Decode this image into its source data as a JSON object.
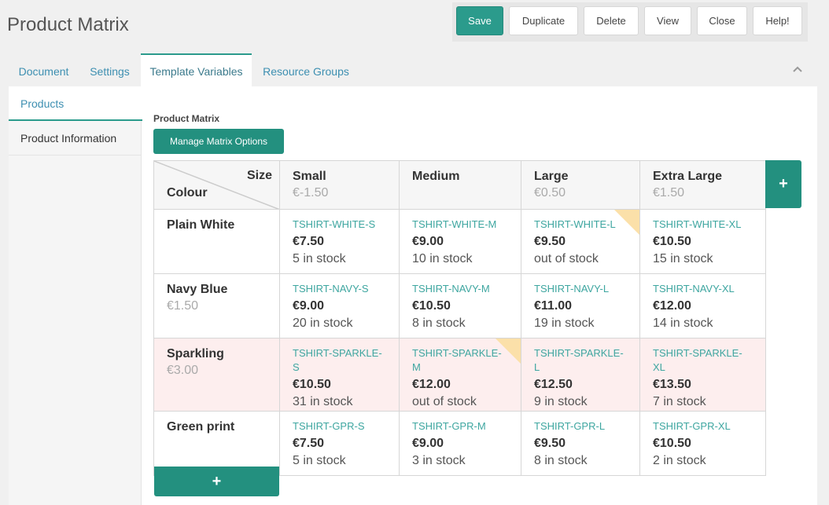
{
  "page": {
    "title": "Product Matrix"
  },
  "toolbar": {
    "save": "Save",
    "duplicate": "Duplicate",
    "delete": "Delete",
    "view": "View",
    "close": "Close",
    "help": "Help!"
  },
  "tabs": [
    "Document",
    "Settings",
    "Template Variables",
    "Resource Groups"
  ],
  "active_tab": "Template Variables",
  "vertical_tabs": [
    "Products",
    "Product Information"
  ],
  "active_vertical_tab": "Products",
  "field": {
    "label": "Product Matrix",
    "manage_button": "Manage Matrix Options",
    "add_column_icon": "+",
    "add_row_icon": "+"
  },
  "matrix": {
    "corner": {
      "size": "Size",
      "colour": "Colour"
    },
    "columns": [
      {
        "name": "Small",
        "price": "€-1.50"
      },
      {
        "name": "Medium",
        "price": ""
      },
      {
        "name": "Large",
        "price": "€0.50"
      },
      {
        "name": "Extra Large",
        "price": "€1.50"
      }
    ],
    "rows": [
      {
        "name": "Plain White",
        "price": "",
        "highlight": false,
        "cells": [
          {
            "sku": "TSHIRT-WHITE-S",
            "price": "€7.50",
            "stock": "5 in stock"
          },
          {
            "sku": "TSHIRT-WHITE-M",
            "price": "€9.00",
            "stock": "10 in stock"
          },
          {
            "sku": "TSHIRT-WHITE-L",
            "price": "€9.50",
            "stock": "out of stock",
            "flag": true
          },
          {
            "sku": "TSHIRT-WHITE-XL",
            "price": "€10.50",
            "stock": "15 in stock"
          }
        ]
      },
      {
        "name": "Navy Blue",
        "price": "€1.50",
        "highlight": false,
        "cells": [
          {
            "sku": "TSHIRT-NAVY-S",
            "price": "€9.00",
            "stock": "20 in stock"
          },
          {
            "sku": "TSHIRT-NAVY-M",
            "price": "€10.50",
            "stock": "8 in stock"
          },
          {
            "sku": "TSHIRT-NAVY-L",
            "price": "€11.00",
            "stock": "19 in stock"
          },
          {
            "sku": "TSHIRT-NAVY-XL",
            "price": "€12.00",
            "stock": "14 in stock"
          }
        ]
      },
      {
        "name": "Sparkling",
        "price": "€3.00",
        "highlight": true,
        "cells": [
          {
            "sku": "TSHIRT-SPARKLE-S",
            "price": "€10.50",
            "stock": "31 in stock"
          },
          {
            "sku": "TSHIRT-SPARKLE-M",
            "price": "€12.00",
            "stock": "out of stock",
            "flag": true
          },
          {
            "sku": "TSHIRT-SPARKLE-L",
            "price": "€12.50",
            "stock": "9 in stock"
          },
          {
            "sku": "TSHIRT-SPARKLE-XL",
            "price": "€13.50",
            "stock": "7 in stock"
          }
        ]
      },
      {
        "name": "Green print",
        "price": "",
        "highlight": false,
        "cells": [
          {
            "sku": "TSHIRT-GPR-S",
            "price": "€7.50",
            "stock": "5 in stock"
          },
          {
            "sku": "TSHIRT-GPR-M",
            "price": "€9.00",
            "stock": "3 in stock"
          },
          {
            "sku": "TSHIRT-GPR-L",
            "price": "€9.50",
            "stock": "8 in stock"
          },
          {
            "sku": "TSHIRT-GPR-XL",
            "price": "€10.50",
            "stock": "2 in stock"
          }
        ]
      }
    ]
  },
  "colors": {
    "accent": "#23907f",
    "link": "#3d8fb1",
    "sku": "#3ea6a0",
    "highlight_row": "#fdeeee",
    "flag": "#fbe0a9"
  }
}
